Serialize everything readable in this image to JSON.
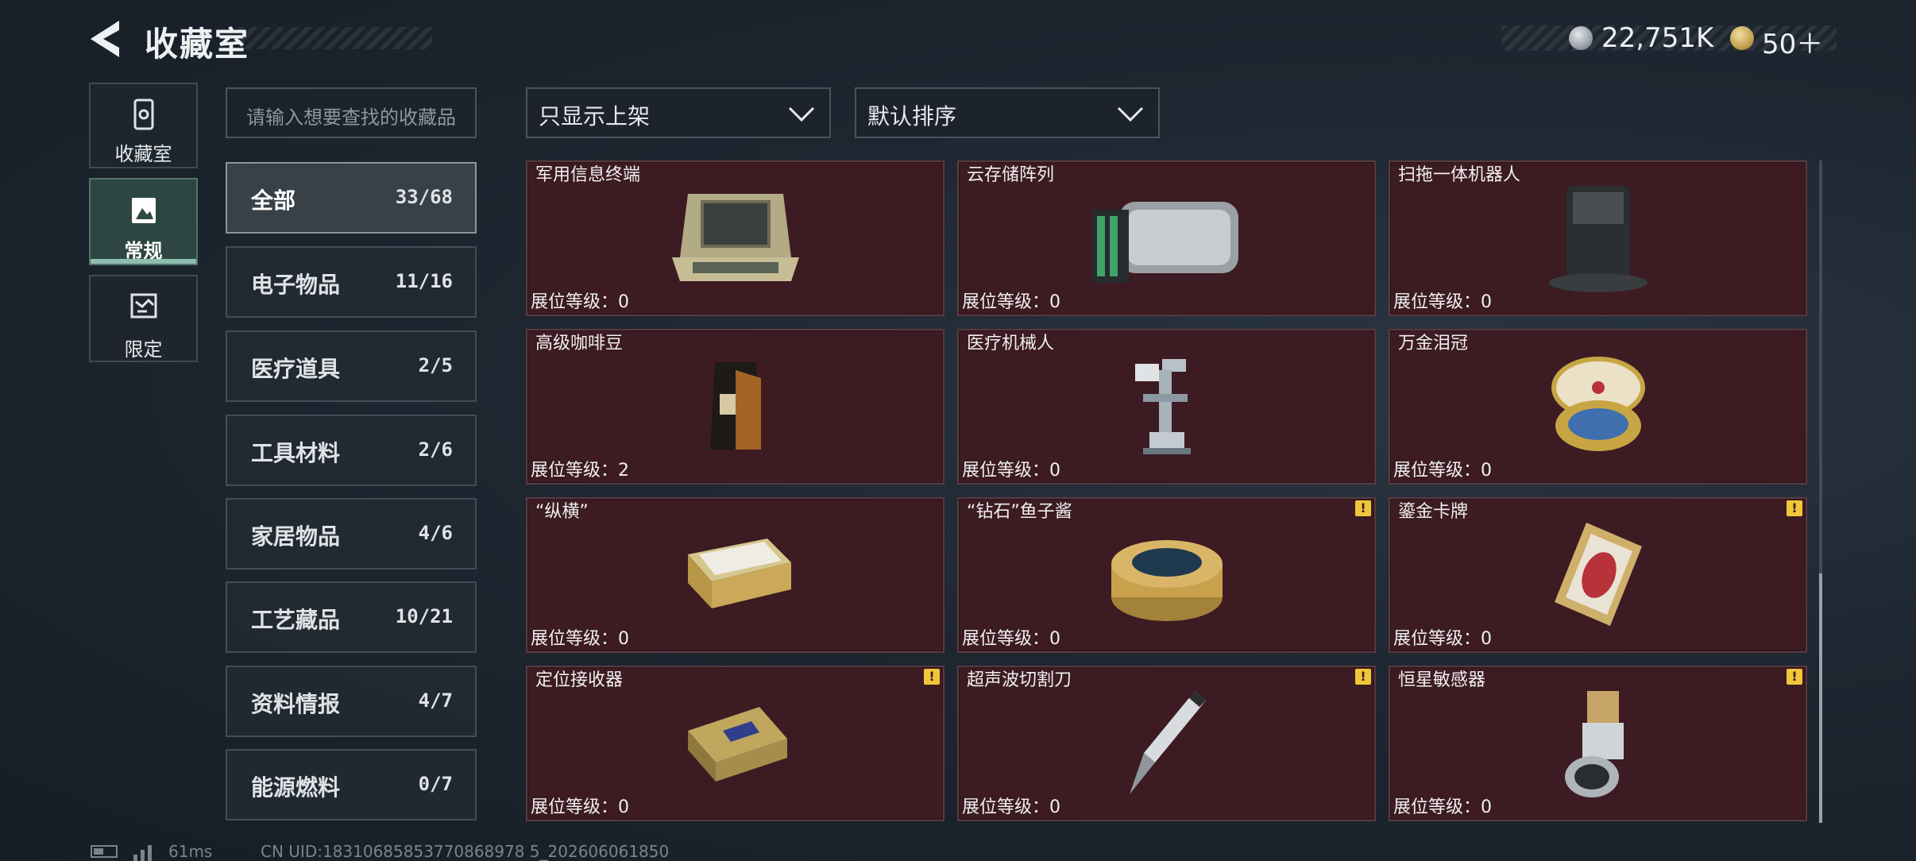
{
  "header": {
    "title": "收藏室",
    "currency_silver": "22,751K",
    "currency_gold": "50＋"
  },
  "side_nav": [
    {
      "label": "收藏室",
      "icon": "phone-icon",
      "active": false
    },
    {
      "label": "常规",
      "icon": "photo-frame-icon",
      "active": true
    },
    {
      "label": "限定",
      "icon": "map-icon",
      "active": false
    }
  ],
  "search": {
    "placeholder": "请输入想要查找的收藏品"
  },
  "filters": {
    "display_filter": "只显示上架",
    "sort": "默认排序"
  },
  "categories": [
    {
      "name": "全部",
      "count": "33/68",
      "active": true
    },
    {
      "name": "电子物品",
      "count": "11/16"
    },
    {
      "name": "医疗道具",
      "count": "2/5"
    },
    {
      "name": "工具材料",
      "count": "2/6"
    },
    {
      "name": "家居物品",
      "count": "4/6"
    },
    {
      "name": "工艺藏品",
      "count": "10/21"
    },
    {
      "name": "资料情报",
      "count": "4/7"
    },
    {
      "name": "能源燃料",
      "count": "0/7"
    }
  ],
  "items": [
    {
      "name": "军用信息终端",
      "level": "展位等级：0",
      "icon": "rugged-laptop-case-icon",
      "warn": false
    },
    {
      "name": "云存储阵列",
      "level": "展位等级：0",
      "icon": "server-array-icon",
      "warn": false
    },
    {
      "name": "扫拖一体机器人",
      "level": "展位等级：0",
      "icon": "robot-vacuum-station-icon",
      "warn": false
    },
    {
      "name": "高级咖啡豆",
      "level": "展位等级：2",
      "icon": "coffee-bag-icon",
      "warn": false
    },
    {
      "name": "医疗机械人",
      "level": "展位等级：0",
      "icon": "medical-robot-icon",
      "warn": false
    },
    {
      "name": "万金泪冠",
      "level": "展位等级：0",
      "icon": "jeweled-egg-icon",
      "warn": false
    },
    {
      "name": "“纵横”",
      "level": "展位等级：0",
      "icon": "chess-box-icon",
      "warn": false
    },
    {
      "name": "“钻石”鱼子酱",
      "level": "展位等级：0",
      "icon": "caviar-tin-icon",
      "warn": true
    },
    {
      "name": "鎏金卡牌",
      "level": "展位等级：0",
      "icon": "gilded-card-icon",
      "warn": true
    },
    {
      "name": "定位接收器",
      "level": "展位等级：0",
      "icon": "gps-receiver-icon",
      "warn": true
    },
    {
      "name": "超声波切割刀",
      "level": "展位等级：0",
      "icon": "ultrasonic-cutter-icon",
      "warn": true
    },
    {
      "name": "恒星敏感器",
      "level": "展位等级：0",
      "icon": "star-sensor-icon",
      "warn": true
    }
  ],
  "warn_glyph": "!",
  "status": {
    "ping": "61ms",
    "uid": "CN UID:18310685853770868978 5_202606061850"
  }
}
